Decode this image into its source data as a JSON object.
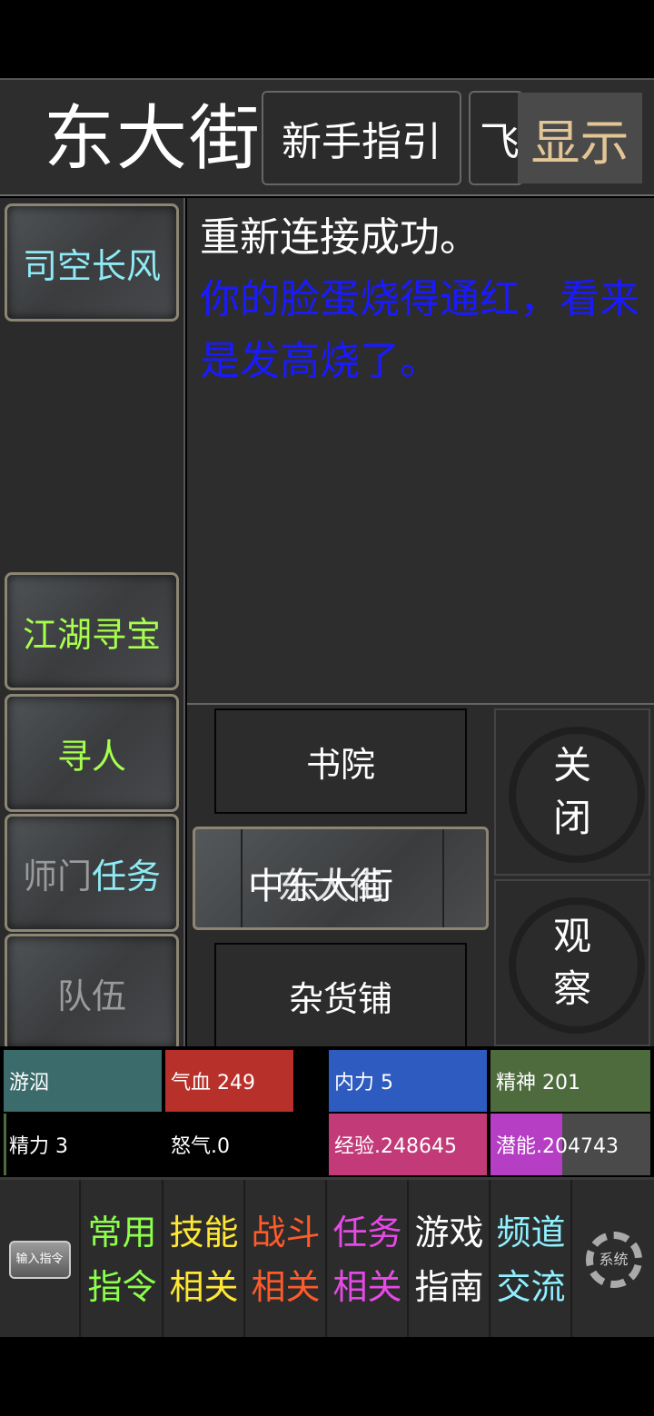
{
  "header": {
    "location": "东大街",
    "guide_button": "新手指引",
    "partial_button": "飞",
    "show_button": "显示"
  },
  "sidebar": {
    "npc_button": "司空长风",
    "treasure_button": "江湖寻宝",
    "find_person_button": "寻人",
    "sect_task_prefix": "师门",
    "sect_task_suffix": "任务",
    "team_button": "队伍"
  },
  "log": {
    "lines": [
      {
        "text": "重新连接成功。",
        "color": "#ffffff"
      },
      {
        "text": "你的脸蛋烧得通红，看来是发高烧了。",
        "color": "#1a1aff"
      }
    ]
  },
  "exits": {
    "north": "书院",
    "center_overlap_a": "中东大街",
    "center_overlap_b": "东大街",
    "south": "杂货铺",
    "close_button": "关闭",
    "observe_button": "观察"
  },
  "stats": {
    "status": "游泅",
    "hp": {
      "label": "气血 249",
      "fill": 0.8
    },
    "mp": {
      "label": "内力 5",
      "fill": 1.0
    },
    "spirit": {
      "label": "精神 201",
      "fill": 1.0
    },
    "energy": {
      "label": "精力 3",
      "fill": 0.02
    },
    "rage": {
      "label": "怒气.0",
      "fill": 0
    },
    "exp": {
      "label": "经验.248645",
      "fill": 1.0
    },
    "potential": {
      "label": "潜能.204743",
      "fill": 0.45
    }
  },
  "bottom_menu": {
    "input_cmd_icon": "输入指令",
    "items": [
      {
        "line1": "常用",
        "line2": "指令",
        "color": "#8cff4a"
      },
      {
        "line1": "技能",
        "line2": "相关",
        "color": "#ffe733"
      },
      {
        "line1": "战斗",
        "line2": "相关",
        "color": "#ff5a2a"
      },
      {
        "line1": "任务",
        "line2": "相关",
        "color": "#e64ae6"
      },
      {
        "line1": "游戏",
        "line2": "指南",
        "color": "#ffffff"
      },
      {
        "line1": "频道",
        "line2": "交流",
        "color": "#8ff0ff"
      }
    ],
    "system_icon": "系统"
  }
}
